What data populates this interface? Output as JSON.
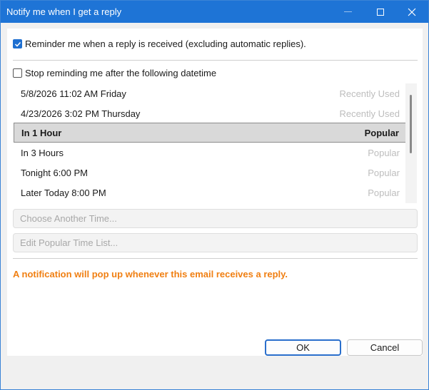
{
  "window": {
    "title": "Notify me when I get a reply"
  },
  "options": {
    "reminder_label": "Reminder me when a reply is received (excluding automatic replies).",
    "reminder_checked": true,
    "stop_label": "Stop reminding me after the following datetime",
    "stop_checked": false
  },
  "time_list": {
    "items": [
      {
        "label": "5/8/2026 11:02 AM Friday",
        "tag": "Recently Used",
        "selected": false
      },
      {
        "label": "4/23/2026 3:02 PM Thursday",
        "tag": "Recently Used",
        "selected": false
      },
      {
        "label": "In 1 Hour",
        "tag": "Popular",
        "selected": true
      },
      {
        "label": "In 3 Hours",
        "tag": "Popular",
        "selected": false
      },
      {
        "label": "Tonight 6:00 PM",
        "tag": "Popular",
        "selected": false
      },
      {
        "label": "Later Today 8:00 PM",
        "tag": "Popular",
        "selected": false
      }
    ]
  },
  "buttons": {
    "choose_another": "Choose Another Time...",
    "edit_popular": "Edit Popular Time List...",
    "ok": "OK",
    "cancel": "Cancel"
  },
  "notice": "A notification will pop up whenever this email receives a reply.",
  "colors": {
    "titlebar": "#1e74d6",
    "accent": "#1e6fd0",
    "notice": "#f07f12"
  }
}
